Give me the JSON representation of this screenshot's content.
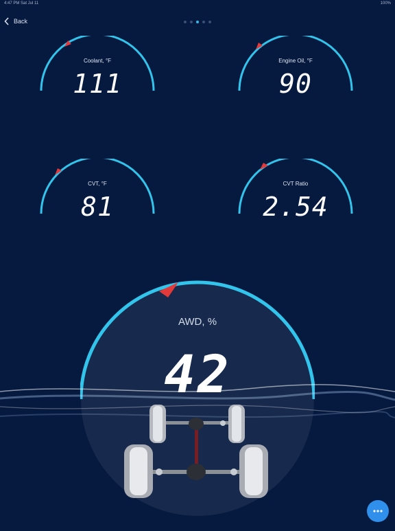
{
  "status_bar": {
    "left": "4:47 PM   Sat Jul 11",
    "right": "100%"
  },
  "nav": {
    "back_label": "Back"
  },
  "pager": {
    "count": 5,
    "active": 2
  },
  "gauges": [
    {
      "label": "Coolant, °F",
      "value": "111"
    },
    {
      "label": "Engine Oil, °F",
      "value": "90"
    },
    {
      "label": "CVT, °F",
      "value": "81"
    },
    {
      "label": "CVT Ratio",
      "value": "2.54"
    }
  ],
  "awd": {
    "label": "AWD, %",
    "value": "42"
  },
  "colors": {
    "background": "#061a40",
    "arc": "#33c4ec",
    "pointer": "#e23a3a",
    "fab": "#2f8fea"
  },
  "icons": {
    "back": "chevron-left-icon",
    "fab": "more-horizontal-icon",
    "drivetrain": "drivetrain-icon"
  }
}
